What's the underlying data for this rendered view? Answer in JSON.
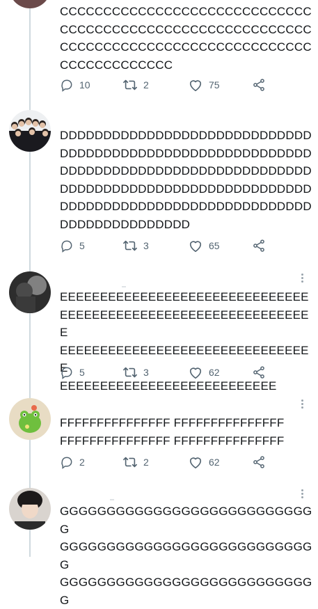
{
  "tweets": [
    {
      "text": "CCCCCCCCCCCCCCCCCCCCCCCCCCCCC\nCCCCCCCCCCCCCCCCCCCCCCCCCCCCC\nCCCCCCCCCCCCCCCCCCCCCCCCCCCCC\nCCCCCCCCCCCCC",
      "replies": "10",
      "retweets": "2",
      "likes": "75"
    },
    {
      "text": "DDDDDDDDDDDDDDDDDDDDDDDDDDDDD\nDDDDDDDDDDDDDDDDDDDDDDDDDDDDD\nDDDDDDDDDDDDDDDDDDDDDDDDDDDDD\nDDDDDDDDDDDDDDDDDDDDDDDDDDDDD\nDDDDDDDDDDDDDDDDDDDDDDDDDDDDD\nDDDDDDDDDDDDDDD",
      "replies": "5",
      "retweets": "3",
      "likes": "65"
    },
    {
      "text": "EEEEEEEEEEEEEEEEEEEEEEEEEEEEEEE\nEEEEEEEEEEEEEEEEEEEEEEEEEEEEEEEE\nEEEEEEEEEEEEEEEEEEEEEEEEEEEEEEEE\nEEEEEEEEEEEEEEEEEEEEEEEEEEE",
      "replies": "5",
      "retweets": "3",
      "likes": "62"
    },
    {
      "text": "FFFFFFFFFFFFFFF FFFFFFFFFFFFFFF\nFFFFFFFFFFFFFFF FFFFFFFFFFFFFFF",
      "replies": "2",
      "retweets": "2",
      "likes": "62"
    },
    {
      "text": "GGGGGGGGGGGGGGGGGGGGGGGGGGGG\nGGGGGGGGGGGGGGGGGGGGGGGGGGGG\nGGGGGGGGGGGGGGGGGGGGGGGGGGGG"
    }
  ],
  "icons": {
    "reply": "reply-icon",
    "retweet": "retweet-icon",
    "like": "heart-icon",
    "share": "share-icon",
    "more": "more-vertical-icon"
  },
  "colors": {
    "text": "#14171a",
    "icon": "#536471",
    "thread_line": "#cfd9de"
  }
}
